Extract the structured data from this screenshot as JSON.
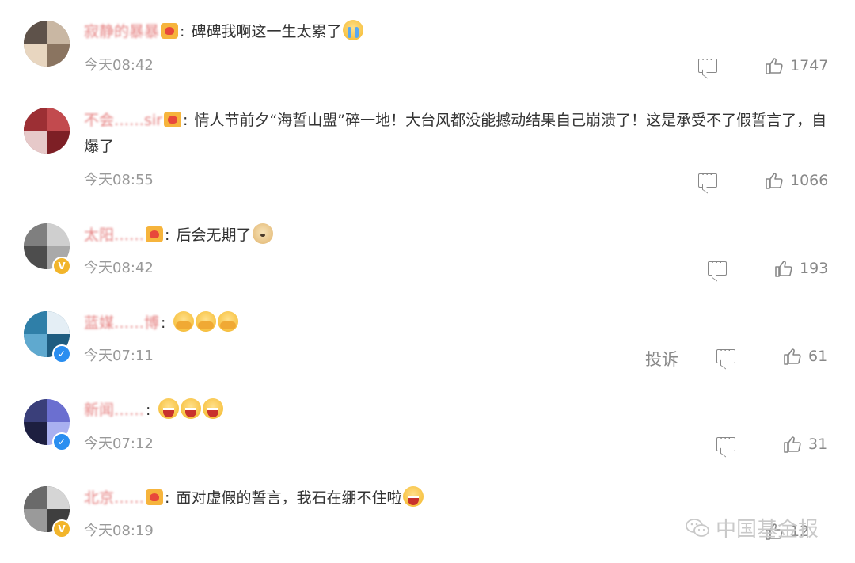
{
  "comments": [
    {
      "user": "寂静的暴暴",
      "text": "碑碑我啊这一生太累了",
      "emoji": [
        "cry"
      ],
      "time": "今天08:42",
      "likes": "1747",
      "avatar_colors": [
        "#5e524a",
        "#c9b7a3",
        "#e8d6c0",
        "#8a7460"
      ],
      "badge": ""
    },
    {
      "user": "不会……sir",
      "text": "情人节前夕“海誓山盟”碎一地！大台风都没能撼动结果自己崩溃了！这是承受不了假誓言了，自爆了",
      "emoji": [],
      "time": "今天08:55",
      "likes": "1066",
      "avatar_colors": [
        "#9c2f34",
        "#c24a4e",
        "#e6c9c9",
        "#7d1f25"
      ],
      "badge": ""
    },
    {
      "user": "太阳……",
      "text": "后会无期了",
      "emoji": [
        "doge"
      ],
      "time": "今天08:42",
      "likes": "193",
      "avatar_colors": [
        "#7f7f7f",
        "#cfcfcf",
        "#4d4d4d",
        "#a9a9a9"
      ],
      "badge": "gold"
    },
    {
      "user": "蓝媒……博",
      "text": "",
      "emoji": [
        "cover",
        "cover",
        "cover"
      ],
      "time": "今天07:11",
      "likes": "61",
      "avatar_colors": [
        "#2f7fa8",
        "#e4eef5",
        "#5fa9cf",
        "#1e5c80"
      ],
      "badge": "blue",
      "report": "投诉"
    },
    {
      "user": "新闻……",
      "text": "",
      "emoji": [
        "laugh",
        "laugh",
        "laugh"
      ],
      "time": "今天07:12",
      "likes": "31",
      "avatar_colors": [
        "#3a3f7a",
        "#6b6fd0",
        "#1d1f40",
        "#a9b0f0"
      ],
      "badge": "blue"
    },
    {
      "user": "北京……",
      "text": "面对虚假的誓言，我石在绷不住啦",
      "emoji": [
        "laugh"
      ],
      "time": "今天08:19",
      "likes": "12",
      "avatar_colors": [
        "#6a6a6a",
        "#d5d5d5",
        "#9a9a9a",
        "#3f3f3f"
      ],
      "badge": "gold"
    }
  ],
  "watermark": "中国基金报",
  "colors": {
    "username": "#e06a6a",
    "meta": "#999999",
    "text": "#333333"
  }
}
